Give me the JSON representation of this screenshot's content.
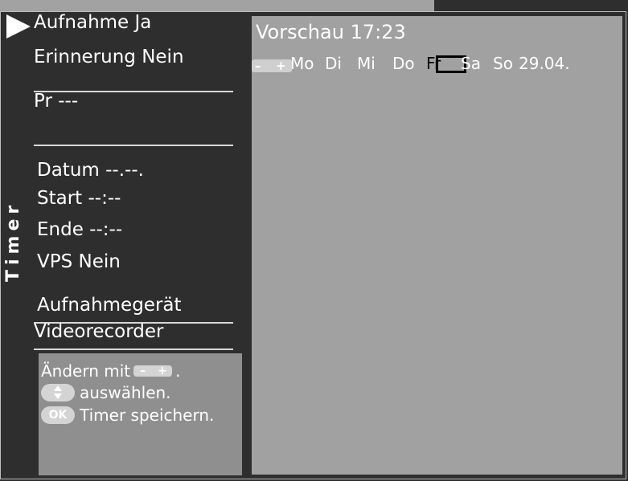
{
  "sidebar": {
    "title": "Timer",
    "items": {
      "aufnahme": "Aufnahme Ja",
      "erinnerung": "Erinnerung Nein",
      "pr": "Pr   ---",
      "datum": "Datum --.--.",
      "start": "Start --:--",
      "ende": "Ende --:--",
      "vps": "VPS Nein",
      "geraet_label": "Aufnahmegerät",
      "geraet_value": "Videorecorder"
    }
  },
  "help": {
    "line1_text": "Ändern mit",
    "line1_suffix": ".",
    "pill_minus": "–",
    "pill_plus": "+",
    "line2_text": "auswählen.",
    "ok_label": "OK",
    "line3_text": "Timer speichern."
  },
  "preview": {
    "title": "Vorschau 17:23",
    "pill_minus": "–",
    "pill_plus": "+",
    "days": [
      "Mo",
      "Di",
      "Mi",
      "Do",
      "Fr",
      "Sa",
      "So"
    ],
    "date": "29.04.",
    "selected_day": "Fr"
  },
  "colors": {
    "background": "#2e2e2e",
    "preview_panel": "#a1a1a1",
    "help_panel": "#8f8f8f",
    "text": "#ffffff",
    "cursor": "#000000"
  }
}
